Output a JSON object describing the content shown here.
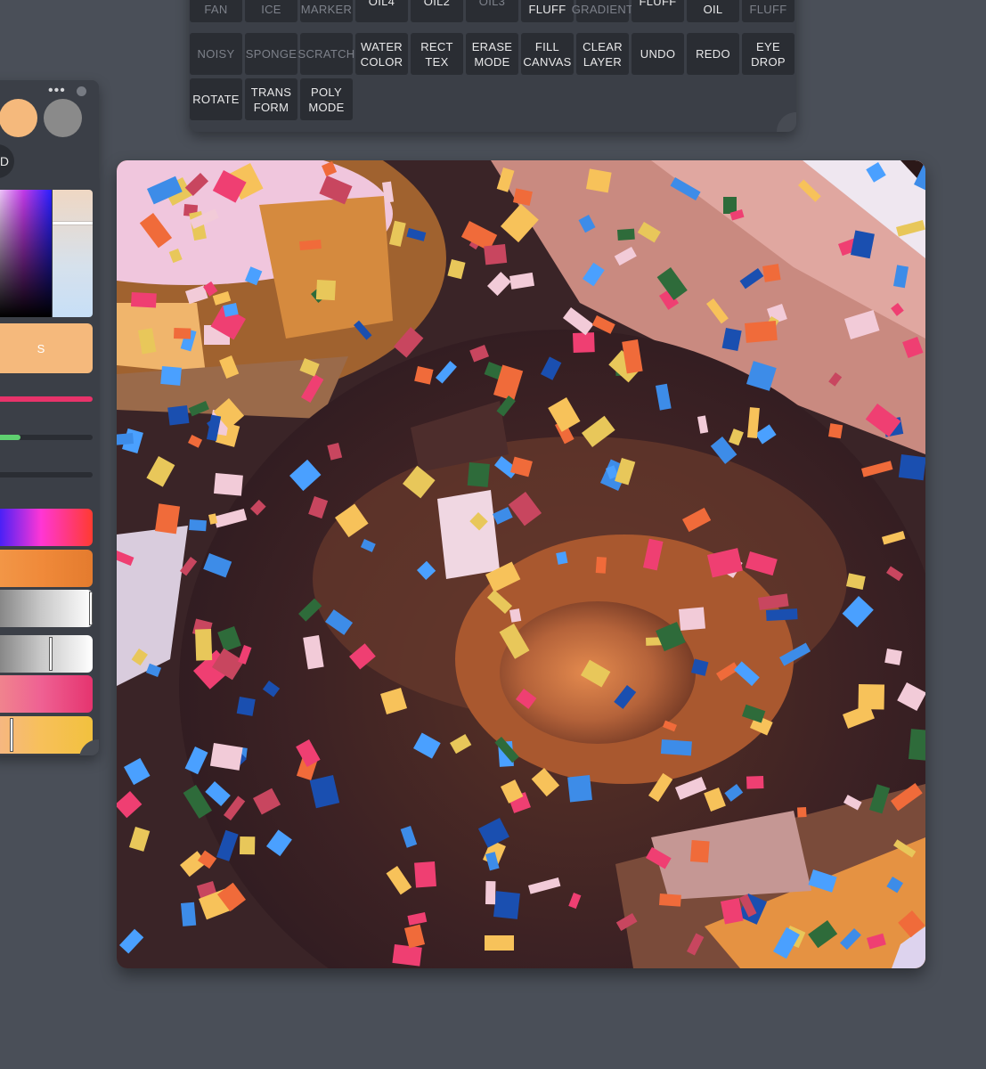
{
  "toolbar": {
    "row1": [
      "BLUR\nFAN",
      "BLUR\nICE",
      "DRY\nMARKER",
      "OIL4",
      "OIL2",
      "OIL3",
      "SMUDGE\nFLUFF",
      "BLUR FAN\nGRADIENT",
      "FLUFF",
      "DRY\nOIL",
      "FRIED\nFLUFF"
    ],
    "row2": [
      "NOISY",
      "SPONGE",
      "SCRATCH",
      "WATER\nCOLOR",
      "RECT\nTEX",
      "ERASE\nMODE",
      "FILL\nCANVAS",
      "CLEAR\nLAYER",
      "UNDO",
      "REDO",
      "EYE\nDROP"
    ],
    "row3": [
      "ROTATE",
      "TRANS\nFORM",
      "POLY\nMODE"
    ],
    "dimmed": [
      "BLUR\nFAN",
      "BLUR\nICE",
      "DRY\nMARKER",
      "OIL3",
      "BLUR FAN\nGRADIENT",
      "FRIED\nFLUFF",
      "NOISY",
      "SPONGE",
      "SCRATCH"
    ]
  },
  "color_panel": {
    "more_icon": "more-horizontal-icon",
    "more_glyph": "•••",
    "swatches": [
      "#f5b97c",
      "#8a8a8a"
    ],
    "mode_label": "D",
    "current_label": "S",
    "current_color": "#f5b97c",
    "tint_level": 0.25,
    "sliders": [
      {
        "name": "size",
        "value": 1.0,
        "color": "#e8336a"
      },
      {
        "name": "opacity",
        "value": 0.3,
        "color": "#5fd070"
      },
      {
        "name": "flow",
        "value": 0.0,
        "color": "#5fd070"
      }
    ],
    "gradient_bars": [
      {
        "name": "hue",
        "from": "#1b1bff",
        "mid": "#ff36d5",
        "to": "#ff3b30",
        "handle": null
      },
      {
        "name": "gradient-orange",
        "from": "#f2994a",
        "mid": "#f08a3a",
        "to": "#e47b2e",
        "handle": null
      },
      {
        "name": "gray-ramp-1",
        "from": "#777",
        "mid": "#c8c8c8",
        "to": "#fff",
        "handle": 1.0
      },
      {
        "name": "gray-ramp-2",
        "from": "#777",
        "mid": "#c8c8c8",
        "to": "#fff",
        "handle": 0.58
      },
      {
        "name": "pink-ramp",
        "from": "#f08c8c",
        "mid": "#ef6193",
        "to": "#e5346f",
        "handle": 0.05
      },
      {
        "name": "yellow-ramp",
        "from": "#f5b58a",
        "mid": "#f7c05a",
        "to": "#f2c13e",
        "handle": 0.2
      }
    ]
  },
  "canvas": {
    "subject": "donut-painting",
    "background": "#3a2427"
  }
}
